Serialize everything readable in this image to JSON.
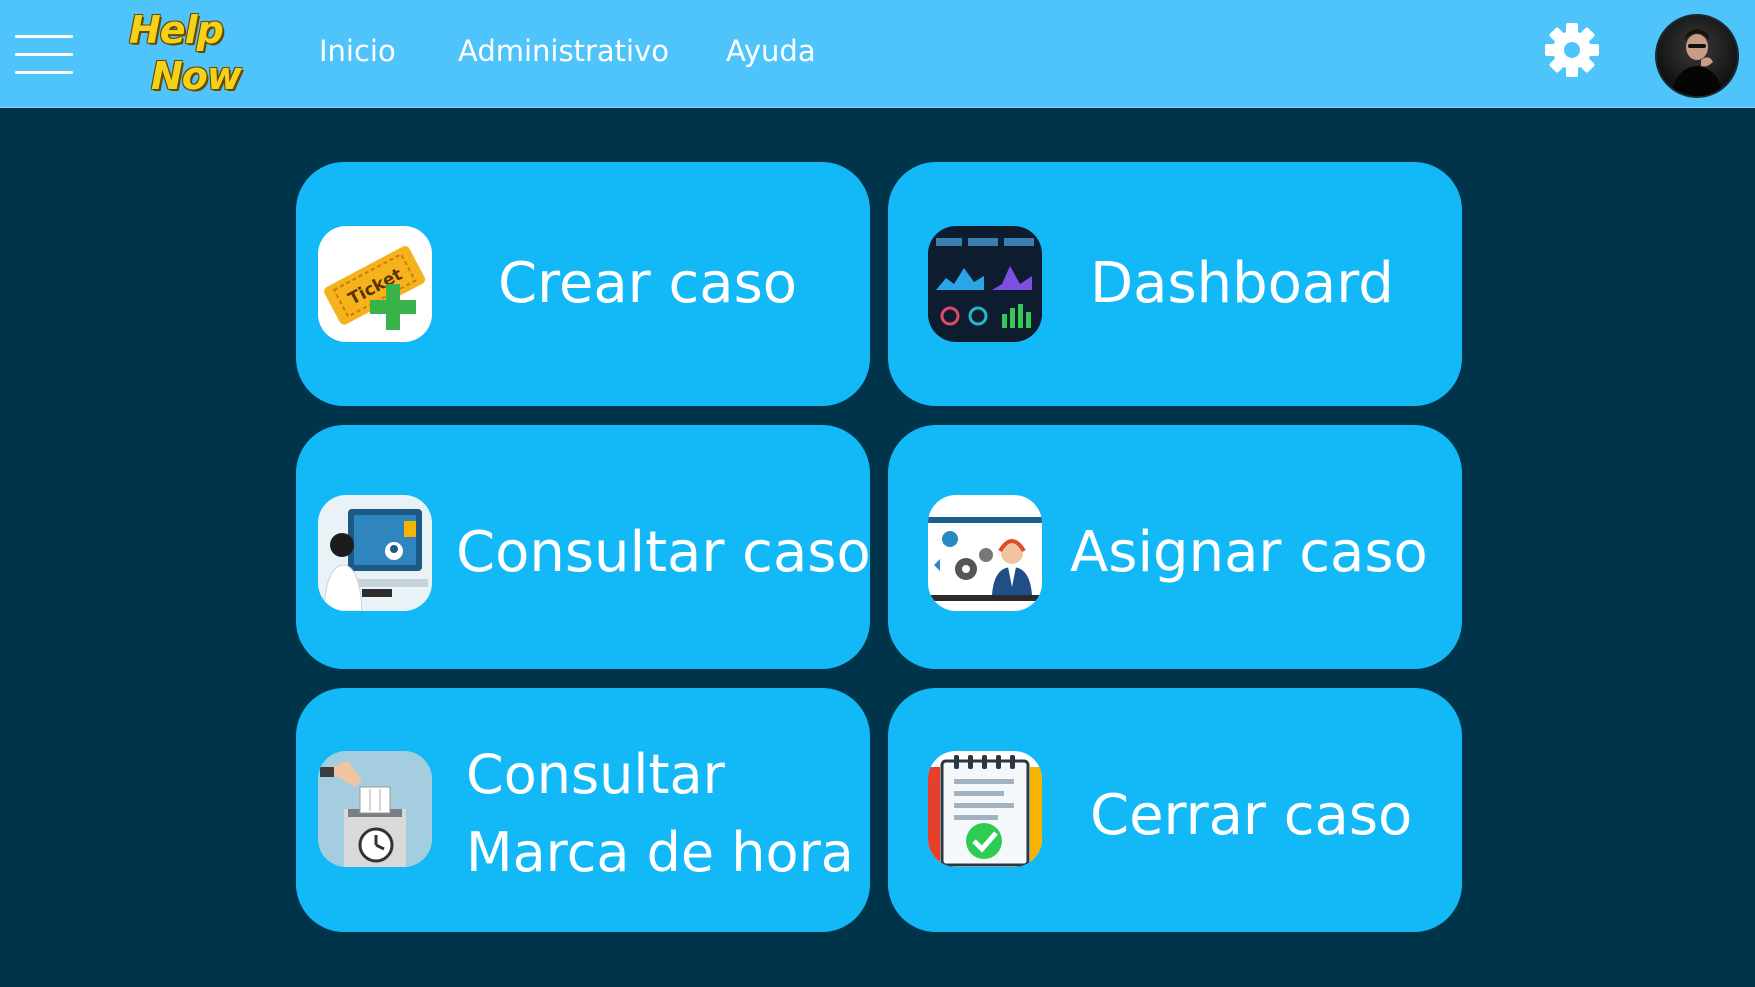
{
  "header": {
    "menu_icon": "hamburger-menu-icon",
    "logo": {
      "line1": "Help",
      "line2": "Now"
    },
    "nav": [
      {
        "label": "Inicio"
      },
      {
        "label": "Administrativo"
      },
      {
        "label": "Ayuda"
      }
    ],
    "settings_icon": "gear-icon",
    "avatar": "user-avatar"
  },
  "tiles": [
    {
      "label": "Crear caso",
      "icon": "ticket-plus-icon"
    },
    {
      "label": "Dashboard",
      "icon": "dashboard-icon"
    },
    {
      "label": "Consultar caso",
      "icon": "consult-case-icon"
    },
    {
      "label": "Asignar caso",
      "icon": "assign-case-icon"
    },
    {
      "label_line1": "Consultar",
      "label_line2": "Marca de hora",
      "icon": "time-clock-icon"
    },
    {
      "label": "Cerrar caso",
      "icon": "close-case-checklist-icon"
    }
  ],
  "colors": {
    "background": "#00344a",
    "header": "#4ec4fa",
    "tile": "#13b9f7",
    "text": "#ffffff",
    "logo": "#f5d21a"
  }
}
